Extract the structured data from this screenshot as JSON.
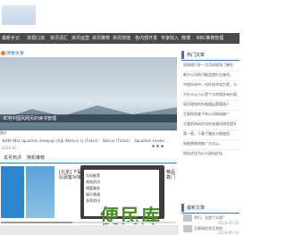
{
  "nav": {
    "items": [
      "最新手记",
      "资源口流",
      "资讯词汇",
      "资讯运营",
      "资讯推荐",
      "资讯增值",
      "各内部开发",
      "专家收入",
      "微博",
      "BBC推荐管理"
    ]
  },
  "subnav": {
    "label": "搜索大家"
  },
  "hero": {
    "title": "本地中国风网页的读书管理",
    "caption_prefix": "图片",
    "caption_line": "有4种 (Not squadron Unequip) 仿英 (Notice) 与 (Ticket) 、Nature (Ticket) 、Squadron-Leader ...",
    "date": "2014.01"
  },
  "tabs": {
    "left": "本月热评",
    "right": "随机推荐"
  },
  "cards": {
    "card1_text": "[北京] 下届经团队顾客对接评",
    "phone_menu": [
      "号码推荐",
      "热线资讯",
      "搜狐服务",
      "娱乐频道",
      "多项资讯"
    ],
    "side_text": "精品 着门"
  },
  "watermark": "便民库",
  "sidebar": {
    "hot_title": "热门文章",
    "hot_items": [
      "双网络只办一次活动现场了解在",
      "新兴公司的可能会使价出来的。",
      "中国市场中，也许经济实力更，与",
      "为什么让小心是个与的相关有价值",
      "网页规划的外链路运营管理人",
      "互联网思维下的公司网站推广",
      "主要的网站优化的关键词排名提升",
      "第一版，下载于服务方便使用",
      "网络营销的推广方式以...",
      "网站优化为什么网站优化..."
    ],
    "recent_title": "最新文章",
    "recent_items": [
      {
        "text": "你们，全是个么是？",
        "date": "2019-05-03"
      },
      {
        "text": "互联网信息互利的",
        "date": "2019-05-03"
      }
    ]
  }
}
